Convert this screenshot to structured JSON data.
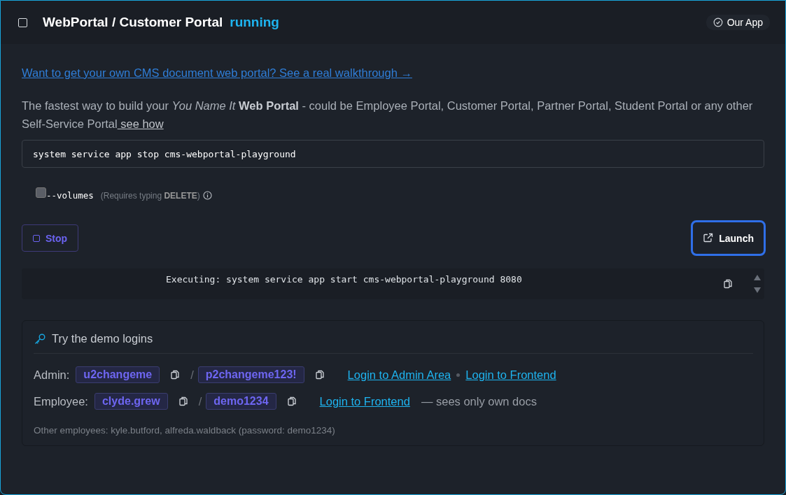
{
  "header": {
    "checked": false,
    "title": "WebPortal / Customer Portal",
    "status": "running",
    "badge": "Our App"
  },
  "intro_link": "Want to get your own CMS document web portal? See a real walkthrough →",
  "description": {
    "text": "The fastest way to build your *You Name It* **Web Portal** - could be Employee Portal, Customer Portal, Partner Portal, Student Portal or any other Self-Service Portal",
    "link": " see how"
  },
  "command": {
    "value": "system service app stop cms-webportal-playground"
  },
  "volumes": {
    "checked": false,
    "label": "--volumes",
    "note": "(Requires typing **DELETE**)"
  },
  "buttons": [
    {
      "kind": "stop",
      "label": "Stop",
      "focused": false
    },
    {
      "kind": "launch",
      "label": "Launch",
      "focused": true
    }
  ],
  "output": "Executing: system service app start cms-webportal-playground 8080",
  "demo": {
    "title": "Try the demo logins",
    "rows": [
      {
        "label": "Admin:",
        "user": "u2changeme",
        "slash": "/",
        "password": "p2changeme123!",
        "links": [
          "Login to Admin Area",
          "Login to Frontend"
        ]
      },
      {
        "label": "Employee:",
        "user": "clyde.grew",
        "slash": "/",
        "password": "demo1234",
        "links": [
          "Login to Frontend"
        ],
        "note": "— sees only own docs"
      }
    ],
    "footer": "Other employees: kyle.butford, alfreda.waldback (password: demo1234)"
  }
}
